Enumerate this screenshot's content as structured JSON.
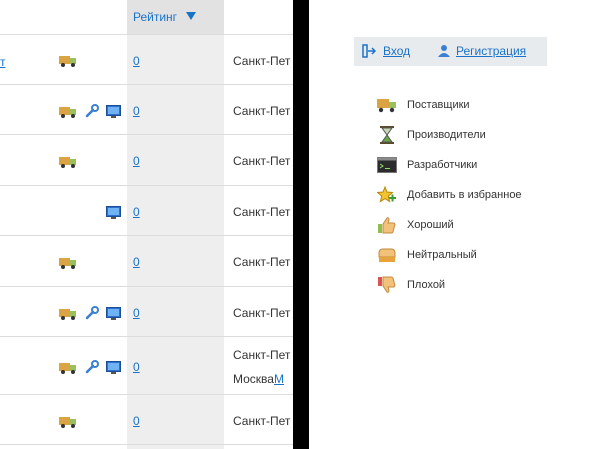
{
  "table": {
    "header": {
      "rating_label": "Рейтинг",
      "sort_icon": "sort-desc-icon"
    },
    "truncated_link": "т",
    "rows": [
      {
        "rating": "0",
        "city": "Санкт-Пет",
        "icons": [
          "truck-icon"
        ]
      },
      {
        "rating": "0",
        "city": "Санкт-Пет",
        "icons": [
          "truck-icon",
          "wrench-icon",
          "monitor-icon"
        ]
      },
      {
        "rating": "0",
        "city": "Санкт-Пет",
        "icons": [
          "truck-icon"
        ]
      },
      {
        "rating": "0",
        "city": "Санкт-Пет",
        "icons": [
          "monitor-icon"
        ]
      },
      {
        "rating": "0",
        "city": "Санкт-Пет",
        "icons": [
          "truck-icon"
        ]
      },
      {
        "rating": "0",
        "city": "Санкт-Пет",
        "icons": [
          "truck-icon",
          "wrench-icon",
          "monitor-icon"
        ]
      },
      {
        "rating": "0",
        "city": "Санкт-Пет",
        "city2": "Москва",
        "city2_link": "М",
        "icons": [
          "truck-icon",
          "wrench-icon",
          "monitor-icon"
        ]
      },
      {
        "rating": "0",
        "city": "Санкт-Пет",
        "icons": [
          "truck-icon"
        ]
      }
    ]
  },
  "auth": {
    "login_label": "Вход",
    "register_label": "Регистрация"
  },
  "legend": [
    {
      "label": "Поставщики",
      "icon": "truck-icon"
    },
    {
      "label": "Производители",
      "icon": "hourglass-icon"
    },
    {
      "label": "Разработчики",
      "icon": "terminal-icon"
    },
    {
      "label": "Добавить в избранное",
      "icon": "star-add-icon"
    },
    {
      "label": "Хороший",
      "icon": "thumbs-up-icon"
    },
    {
      "label": "Нейтральный",
      "icon": "neutral-hand-icon"
    },
    {
      "label": "Плохой",
      "icon": "thumbs-down-icon"
    }
  ],
  "colors": {
    "link": "#1a73c7",
    "divider": "#000000",
    "rating_column": "#eeeeee",
    "auth_bar": "#e8ebee"
  }
}
